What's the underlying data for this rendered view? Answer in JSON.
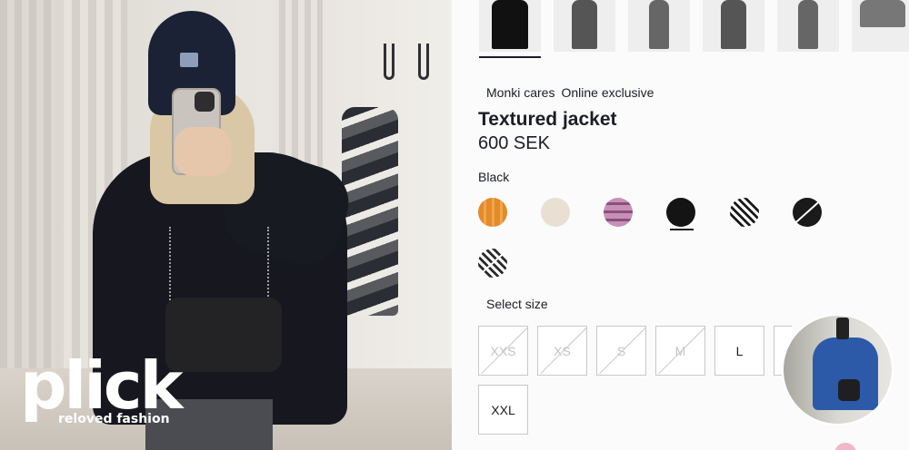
{
  "brand": {
    "logo_word": "plick",
    "logo_tagline": "reloved fashion"
  },
  "gallery": {
    "thumbnails": [
      "product-image-1",
      "product-image-2",
      "product-image-3",
      "product-image-4",
      "product-image-5",
      "product-image-6"
    ],
    "selected_index": 0
  },
  "product": {
    "tags": [
      "Monki cares",
      "Online exclusive"
    ],
    "title": "Textured jacket",
    "price": "600 SEK",
    "selected_color": "Black"
  },
  "colors": [
    {
      "name": "orange-plaid",
      "fill": "#e48a2a",
      "available": true
    },
    {
      "name": "cream",
      "fill": "#e9e0d3",
      "available": true
    },
    {
      "name": "pink-plaid",
      "fill": "#c690b8",
      "available": true
    },
    {
      "name": "black",
      "fill": "#141414",
      "available": true,
      "selected": true
    },
    {
      "name": "houndstooth",
      "fill": "#2a2a2a",
      "available": true
    },
    {
      "name": "black-crossed",
      "fill": "#1a1a1a",
      "available": false
    },
    {
      "name": "houndstooth-crossed",
      "fill": "#3a3a3a",
      "available": false
    }
  ],
  "sizes": {
    "label": "Select size",
    "options": [
      {
        "label": "XXS",
        "available": false
      },
      {
        "label": "XS",
        "available": false
      },
      {
        "label": "S",
        "available": false
      },
      {
        "label": "M",
        "available": false
      },
      {
        "label": "L",
        "available": true
      },
      {
        "label": "XXL",
        "available": true
      }
    ]
  }
}
